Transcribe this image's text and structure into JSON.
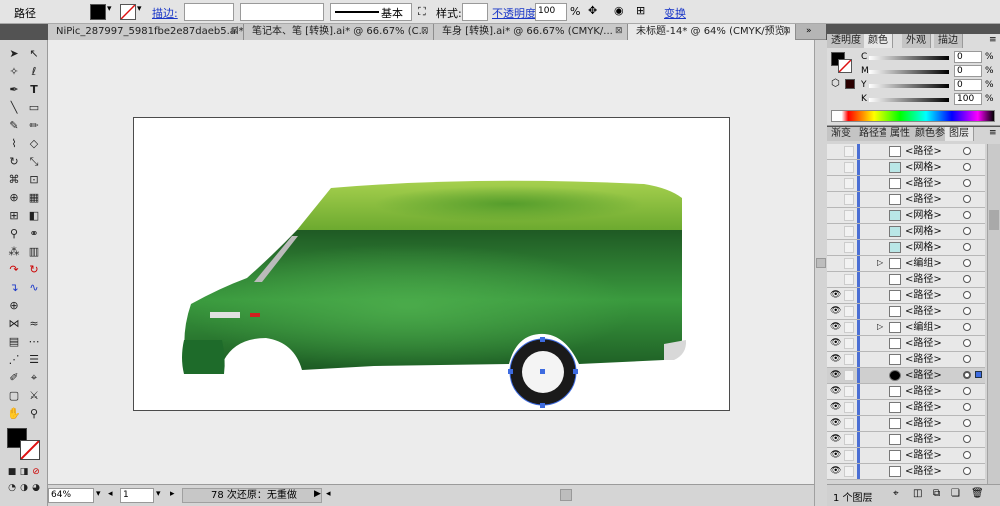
{
  "control_bar": {
    "object_label": "路径",
    "stroke_label": "描边:",
    "stroke_profile": "基本",
    "style_label": "样式:",
    "opacity_label": "不透明度:",
    "opacity_value": "100",
    "opacity_unit": "%",
    "transform_label": "变换"
  },
  "tabs": [
    {
      "label": "NiPic_287997_5981fbe2e87daeb5.ai*"
    },
    {
      "label": "笔记本、笔 [转换].ai* @ 66.67% (C..."
    },
    {
      "label": "车身 [转换].ai* @ 66.67% (CMYK/..."
    },
    {
      "label": "未标题-14* @ 64% (CMYK/预览)"
    }
  ],
  "color_panel": {
    "tabs": [
      "透明度",
      "颜色",
      "外观",
      "描边"
    ],
    "active_tab": "颜色",
    "channels": [
      {
        "name": "C",
        "value": "0"
      },
      {
        "name": "M",
        "value": "0"
      },
      {
        "name": "Y",
        "value": "0"
      },
      {
        "name": "K",
        "value": "100"
      }
    ],
    "unit": "%"
  },
  "layers_panel": {
    "tabs": [
      "渐变",
      "路径查",
      "属性",
      "颜色参",
      "图层"
    ],
    "active_tab": "图层",
    "rows": [
      {
        "name": "<路径>",
        "visible": false
      },
      {
        "name": "<网格>",
        "visible": false
      },
      {
        "name": "<路径>",
        "visible": false
      },
      {
        "name": "<路径>",
        "visible": false
      },
      {
        "name": "<网格>",
        "visible": false
      },
      {
        "name": "<网格>",
        "visible": false
      },
      {
        "name": "<网格>",
        "visible": false
      },
      {
        "name": "<编组>",
        "visible": false
      },
      {
        "name": "<路径>",
        "visible": false
      },
      {
        "name": "<路径>",
        "visible": true
      },
      {
        "name": "<路径>",
        "visible": true
      },
      {
        "name": "<编组>",
        "visible": true
      },
      {
        "name": "<路径>",
        "visible": true
      },
      {
        "name": "<路径>",
        "visible": true
      },
      {
        "name": "<路径>",
        "visible": true,
        "selected": true
      },
      {
        "name": "<路径>",
        "visible": true
      },
      {
        "name": "<路径>",
        "visible": true
      },
      {
        "name": "<路径>",
        "visible": true
      },
      {
        "name": "<路径>",
        "visible": true
      },
      {
        "name": "<路径>",
        "visible": true
      },
      {
        "name": "<路径>",
        "visible": true
      }
    ],
    "footer": "1 个图层"
  },
  "status_bar": {
    "zoom": "64%",
    "page": "1",
    "undo_status": "78 次还原：无重做"
  },
  "colors": {
    "van_body": "#2e8a36",
    "van_roof": "#8cc63e",
    "panel_bg": "#d4d4d4",
    "link": "#1a37c8"
  }
}
